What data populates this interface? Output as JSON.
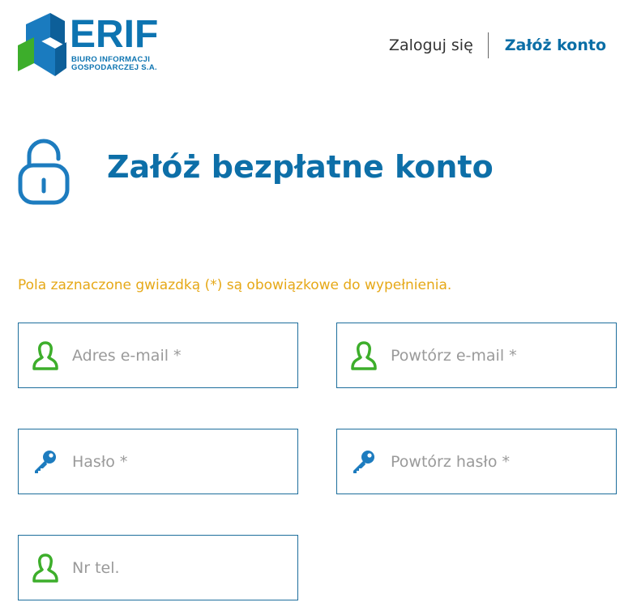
{
  "brand": {
    "name": "ERIF",
    "subtitle_line1": "BIURO INFORMACJI",
    "subtitle_line2": "GOSPODARCZEJ S.A.",
    "colors": {
      "primary": "#0d74b1",
      "green": "#3dae2b",
      "accent": "#e6a817"
    }
  },
  "nav": {
    "login": "Zaloguj się",
    "register": "Załóż konto"
  },
  "page": {
    "title": "Załóż bezpłatne konto",
    "title_icon": "padlock-icon",
    "required_note": "Pola zaznaczone gwiazdką (*) są obowiązkowe do wypełnienia."
  },
  "form": {
    "email": {
      "placeholder": "Adres e-mail *",
      "value": "",
      "icon": "user-icon"
    },
    "email_repeat": {
      "placeholder": "Powtórz e-mail *",
      "value": "",
      "icon": "user-icon"
    },
    "password": {
      "placeholder": "Hasło *",
      "value": "",
      "icon": "key-icon"
    },
    "password_repeat": {
      "placeholder": "Powtórz hasło *",
      "value": "",
      "icon": "key-icon"
    },
    "phone": {
      "placeholder": "Nr tel.",
      "value": "",
      "icon": "user-icon"
    }
  }
}
